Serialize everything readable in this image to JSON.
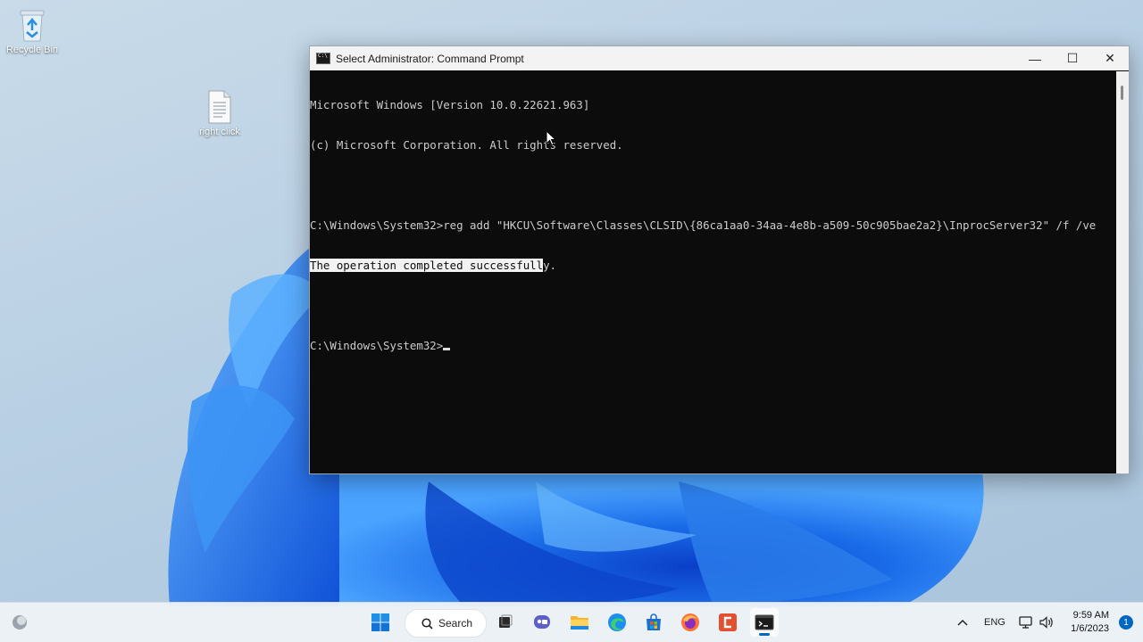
{
  "desktop": {
    "icons": [
      {
        "label": "Recycle Bin",
        "icon": "recycle-bin-icon"
      },
      {
        "label": "right click",
        "icon": "text-file-icon"
      }
    ]
  },
  "window": {
    "title": "Select Administrator: Command Prompt",
    "minimize": "—",
    "maximize": "☐",
    "close": "✕"
  },
  "console": {
    "lines": [
      "Microsoft Windows [Version 10.0.22621.963]",
      "(c) Microsoft Corporation. All rights reserved.",
      "",
      "C:\\Windows\\System32>reg add \"HKCU\\Software\\Classes\\CLSID\\{86ca1aa0-34aa-4e8b-a509-50c905bae2a2}\\InprocServer32\" /f /ve",
      "",
      "",
      "C:\\Windows\\System32>"
    ],
    "selected_text": "The operation completed successfull",
    "after_selection": "y."
  },
  "taskbar": {
    "search_label": "Search",
    "apps": [
      "widgets-icon",
      "start-icon",
      "search-icon",
      "task-view-icon",
      "chat-icon",
      "file-explorer-icon",
      "edge-icon",
      "store-icon",
      "firefox-icon",
      "app-icon",
      "terminal-icon"
    ],
    "language": "ENG",
    "time": "9:59 AM",
    "date": "1/6/2023",
    "notification_count": "1"
  },
  "colors": {
    "console_bg": "#0c0c0c",
    "console_fg": "#cccccc",
    "accent": "#0067c0"
  }
}
